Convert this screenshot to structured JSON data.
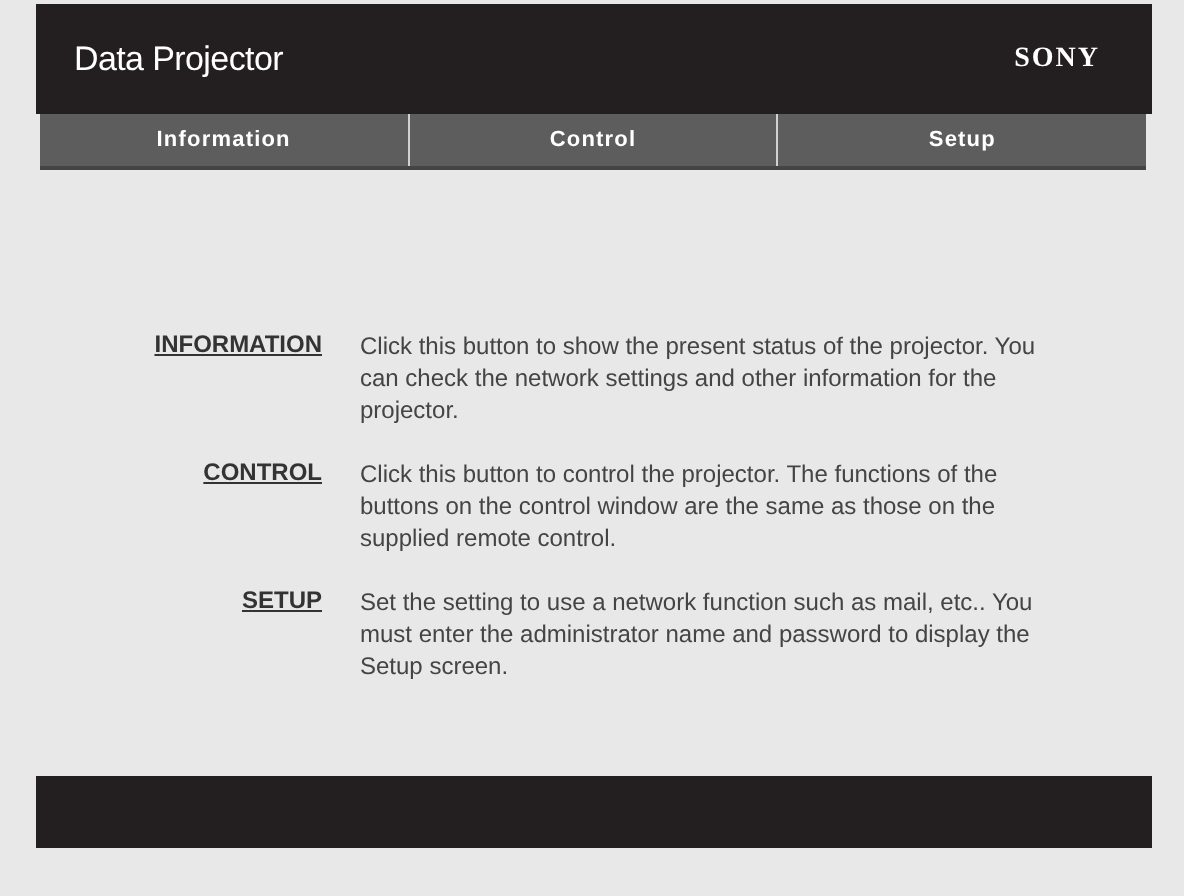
{
  "header": {
    "title": "Data Projector",
    "logo": "SONY"
  },
  "nav": [
    {
      "label": "Information"
    },
    {
      "label": "Control"
    },
    {
      "label": "Setup"
    }
  ],
  "entries": [
    {
      "link": "INFORMATION",
      "text": "Click this button to show the present status of the projector. You can check the network settings and other information for the projector."
    },
    {
      "link": "CONTROL",
      "text": "Click this button to control the projector. The functions of the buttons on the control window are the same as those on the supplied remote control."
    },
    {
      "link": "SETUP",
      "text": "Set the setting to use a network function such as mail, etc.. You must enter the administrator name and password to display the Setup screen."
    }
  ]
}
